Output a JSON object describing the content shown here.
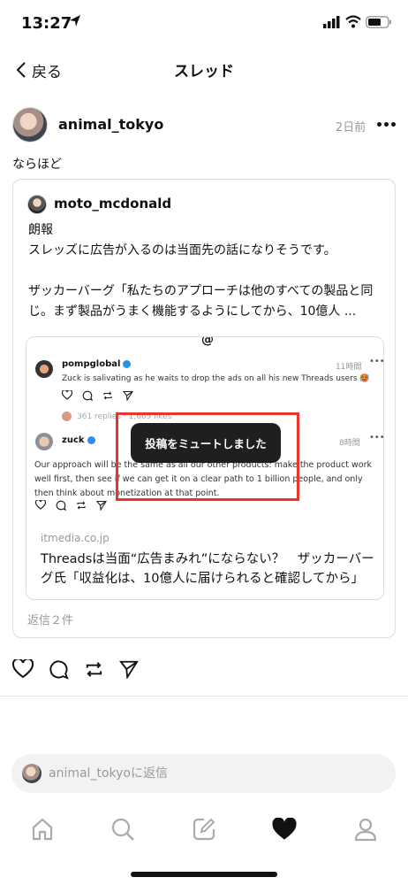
{
  "status_bar": {
    "time": "13:27"
  },
  "nav": {
    "back_label": "戻る",
    "title": "スレッド"
  },
  "post": {
    "author": "animal_tokyo",
    "time_ago": "2日前",
    "text": "ならほど"
  },
  "quoted_post": {
    "author": "moto_mcdonald",
    "lines": [
      "朗報",
      "スレッズに広告が入るのは当面先の話になりそうです。",
      "",
      "ザッカーバーグ「私たちのアプローチは他のすべての製品と同",
      "じ。まず製品がうまく機能するようにしてから、10億人 ..."
    ],
    "replies": "返信２件",
    "link_card": {
      "screenshot": {
        "post1_author": "pompglobal",
        "post1_time": "11時間",
        "post1_text": "Zuck is salivating as he waits to drop the ads on all his new Threads users 🥵",
        "post1_meta": "361 replies · 1,669 likes",
        "post2_author": "zuck",
        "post2_time": "8時間",
        "post2_text": "Our approach will be the same as all our other products: make the product work well first, then see if we can get it on a clear path to 1 billion people, and only then think about monetization at that point."
      },
      "toast": "投稿をミュートしました",
      "domain": "itmedia.co.jp",
      "title": "Threadsは当面“広告まみれ”にならない？　ザッカーバーグ氏「収益化は、10億人に届けられると確認してから」"
    }
  },
  "reply_bar": {
    "placeholder": "animal_tokyoに返信"
  },
  "colors": {
    "highlight": "#e8362f",
    "toast_bg": "#1f1f1f",
    "muted_text": "#9a9a9a"
  }
}
